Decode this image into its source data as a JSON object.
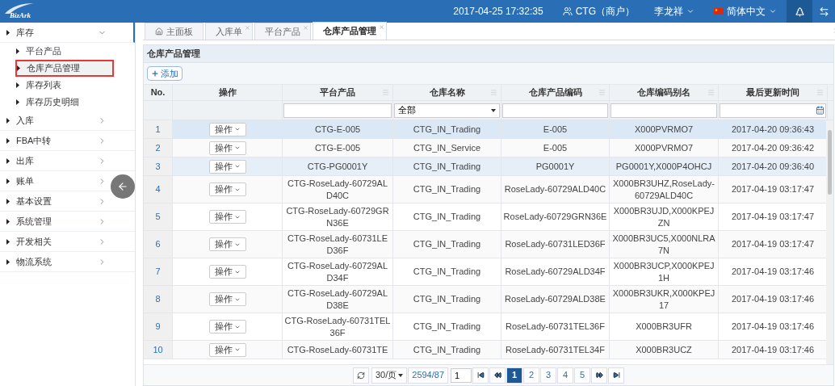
{
  "header": {
    "logo_text": "BizArk",
    "datetime": "2017-04-25 17:32:35",
    "merchant": "CTG（商户）",
    "user": "李龙祥",
    "language": "简体中文"
  },
  "sidebar": {
    "groups": [
      {
        "label": "库存",
        "expanded": true,
        "children": [
          {
            "label": "平台产品",
            "selected": false
          },
          {
            "label": "仓库产品管理",
            "selected": true
          },
          {
            "label": "库存列表",
            "selected": false
          },
          {
            "label": "库存历史明细",
            "selected": false
          }
        ]
      },
      {
        "label": "入库",
        "expanded": false
      },
      {
        "label": "FBA中转",
        "expanded": false
      },
      {
        "label": "出库",
        "expanded": false
      },
      {
        "label": "账单",
        "expanded": false
      },
      {
        "label": "基本设置",
        "expanded": false
      },
      {
        "label": "系统管理",
        "expanded": false
      },
      {
        "label": "开发相关",
        "expanded": false
      },
      {
        "label": "物流系统",
        "expanded": false
      }
    ]
  },
  "tabs": [
    {
      "label": "主面板",
      "kind": "home",
      "selected": false
    },
    {
      "label": "入库单",
      "kind": "closable",
      "selected": false
    },
    {
      "label": "平台产品",
      "kind": "closable",
      "selected": false
    },
    {
      "label": "仓库产品管理",
      "kind": "closable",
      "selected": true
    }
  ],
  "panel": {
    "title": "仓库产品管理",
    "add_button": "添加"
  },
  "table": {
    "columns": [
      "No.",
      "操作",
      "平台产品",
      "仓库名称",
      "仓库产品编码",
      "仓库编码别名",
      "最后更新时间"
    ],
    "filters": {
      "warehouse_select": "全部"
    },
    "rows": [
      {
        "action": "操作",
        "no": "1",
        "product": "CTG-E-005",
        "warehouse": "CTG_IN_Trading",
        "code": "E-005",
        "alias": "X000PVRMO7",
        "updated": "2017-04-20 09:36:43",
        "selected": true,
        "hovered": false
      },
      {
        "action": "操作",
        "no": "2",
        "product": "CTG-E-005",
        "warehouse": "CTG_IN_Service",
        "code": "E-005",
        "alias": "X000PVRMO7",
        "updated": "2017-04-20 09:36:42",
        "selected": false,
        "hovered": false
      },
      {
        "action": "操作",
        "no": "3",
        "product": "CTG-PG0001Y",
        "warehouse": "CTG_IN_Trading",
        "code": "PG0001Y",
        "alias": "PG0001Y,X000P4OHCJ",
        "updated": "2017-04-20 09:36:40",
        "selected": false,
        "hovered": true
      },
      {
        "action": "操作",
        "no": "4",
        "product": "CTG-RoseLady-60729ALD40C",
        "warehouse": "CTG_IN_Trading",
        "code": "RoseLady-60729ALD40C",
        "alias": "X000BR3UHZ,RoseLady-60729ALD40C",
        "updated": "2017-04-19 03:17:47",
        "selected": false,
        "hovered": false
      },
      {
        "action": "操作",
        "no": "5",
        "product": "CTG-RoseLady-60729GRN36E",
        "warehouse": "CTG_IN_Trading",
        "code": "RoseLady-60729GRN36E",
        "alias": "X000BR3UJD,X000KPEJZN",
        "updated": "2017-04-19 03:17:47",
        "selected": false,
        "hovered": false
      },
      {
        "action": "操作",
        "no": "6",
        "product": "CTG-RoseLady-60731LED36F",
        "warehouse": "CTG_IN_Trading",
        "code": "RoseLady-60731LED36F",
        "alias": "X000BR3UC5,X000NLRA7N",
        "updated": "2017-04-19 03:17:47",
        "selected": false,
        "hovered": false
      },
      {
        "action": "操作",
        "no": "7",
        "product": "CTG-RoseLady-60729ALD34F",
        "warehouse": "CTG_IN_Trading",
        "code": "RoseLady-60729ALD34F",
        "alias": "X000BR3UCP,X000KPEJ1H",
        "updated": "2017-04-19 03:17:46",
        "selected": false,
        "hovered": false
      },
      {
        "action": "操作",
        "no": "8",
        "product": "CTG-RoseLady-60729ALD38E",
        "warehouse": "CTG_IN_Trading",
        "code": "RoseLady-60729ALD38E",
        "alias": "X000BR3UKR,X000KPEJ17",
        "updated": "2017-04-19 03:17:46",
        "selected": false,
        "hovered": false
      },
      {
        "action": "操作",
        "no": "9",
        "product": "CTG-RoseLady-60731TEL36F",
        "warehouse": "CTG_IN_Trading",
        "code": "RoseLady-60731TEL36F",
        "alias": "X000BR3UFR",
        "updated": "2017-04-19 03:17:46",
        "selected": false,
        "hovered": false
      },
      {
        "action": "操作",
        "no": "10",
        "product": "CTG-RoseLady-60731TE",
        "warehouse": "CTG_IN_Trading",
        "code": "RoseLady-60731TEL34F",
        "alias": "X000BR3UCZ",
        "updated": "2017-04-19 03:17:46",
        "selected": false,
        "hovered": false
      }
    ]
  },
  "pagination": {
    "page_size": "30/页",
    "total": "2594/87",
    "page_input": "1",
    "pages": [
      {
        "label": "1",
        "selected": true
      },
      {
        "label": "2",
        "selected": false
      },
      {
        "label": "3",
        "selected": false
      },
      {
        "label": "4",
        "selected": false
      },
      {
        "label": "5",
        "selected": false
      }
    ]
  }
}
